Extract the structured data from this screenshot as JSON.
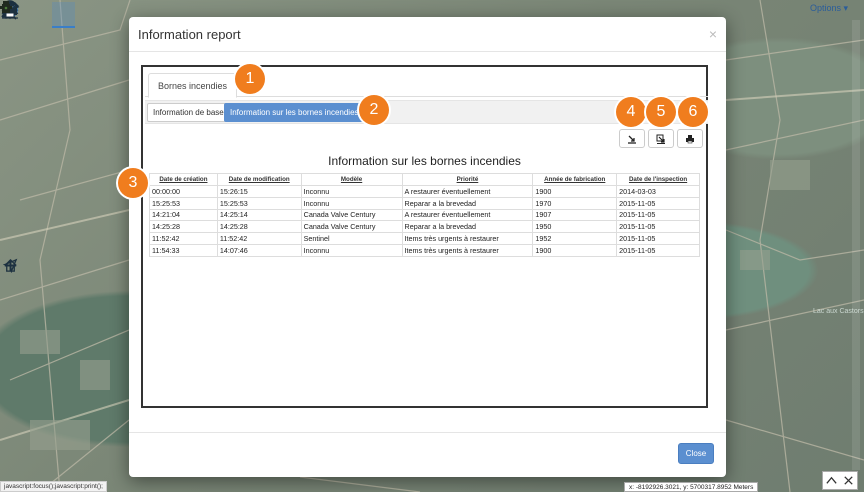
{
  "map": {
    "options_label": "Options",
    "place_label": "Lac aux Castors"
  },
  "toolbar": {
    "icons": [
      "layers-icon",
      "zoom-icon",
      "measure-icon",
      "ruler-icon",
      "tools-icon",
      "person-icon",
      "location-pin-icon",
      "edit-icon",
      "print-icon"
    ]
  },
  "modal": {
    "title": "Information report",
    "close_symbol": "×",
    "tab": "Bornes incendies",
    "subtabs": [
      "Information de base",
      "Information sur les bornes incendies"
    ],
    "report_title": "Information sur les bornes incendies",
    "footer_close_label": "Close"
  },
  "table": {
    "headers": [
      "Date de création",
      "Date de modification",
      "Modèle",
      "Priorité",
      "Année de fabrication",
      "Date de l'inspection"
    ],
    "rows": [
      [
        "00:00:00",
        "15:26:15",
        "Inconnu",
        "A restaurer éventuellement",
        "1900",
        "2014-03-03"
      ],
      [
        "15:25:53",
        "15:25:53",
        "Inconnu",
        "Reparar a la brevedad",
        "1970",
        "2015-11-05"
      ],
      [
        "14:21:04",
        "14:25:14",
        "Canada Valve Century",
        "A restaurer éventuellement",
        "1907",
        "2015-11-05"
      ],
      [
        "14:25:28",
        "14:25:28",
        "Canada Valve Century",
        "Reparar a la brevedad",
        "1950",
        "2015-11-05"
      ],
      [
        "11:52:42",
        "11:52:42",
        "Sentinel",
        "Items très urgents à restaurer",
        "1952",
        "2015-11-05"
      ],
      [
        "11:54:33",
        "14:07:46",
        "Inconnu",
        "Items très urgents à restaurer",
        "1900",
        "2015-11-05"
      ]
    ]
  },
  "callouts": [
    "1",
    "2",
    "3",
    "4",
    "5",
    "6"
  ],
  "status": {
    "link_text": "javascript:focus();javascript:print();",
    "coordinates": "x: -8192926.3021, y: 5700317.8952 Meters"
  },
  "colors": {
    "primary_button": "#5b8fd0",
    "callout": "#f07d1e"
  }
}
